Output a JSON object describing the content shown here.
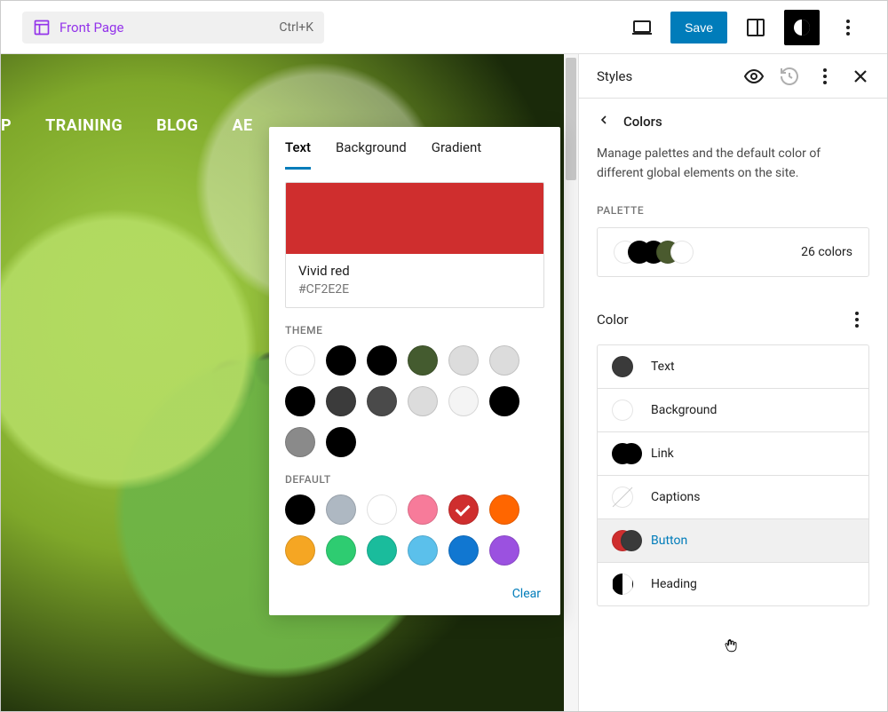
{
  "toolbar": {
    "page_name": "Front Page",
    "shortcut": "Ctrl+K",
    "save_label": "Save"
  },
  "canvas": {
    "nav_items": [
      "P",
      "TRAINING",
      "BLOG",
      "AE"
    ]
  },
  "popover": {
    "tabs": [
      {
        "label": "Text",
        "active": true
      },
      {
        "label": "Background",
        "active": false
      },
      {
        "label": "Gradient",
        "active": false
      }
    ],
    "current_swatch": {
      "name": "Vivid red",
      "hex": "#CF2E2E",
      "color": "#CF2E2E"
    },
    "sections": {
      "theme_label": "THEME",
      "default_label": "DEFAULT"
    },
    "theme_colors": [
      "#ffffff",
      "#000000",
      "#000000",
      "#445b2f",
      "#dcdcdc",
      "#dcdcdc",
      "#000000",
      "#3b3b3b",
      "#4a4a4a",
      "#dcdcdc",
      "#f4f4f4",
      "#000000",
      "#8a8a8a",
      "#000000"
    ],
    "default_colors": [
      {
        "c": "#000000"
      },
      {
        "c": "#aeb8c2"
      },
      {
        "c": "#ffffff"
      },
      {
        "c": "#f77b9a"
      },
      {
        "c": "#CF2E2E",
        "selected": true
      },
      {
        "c": "#ff6600"
      },
      {
        "c": "#f5a623"
      },
      {
        "c": "#2ecc71"
      },
      {
        "c": "#1abc9c"
      },
      {
        "c": "#5bc0eb"
      },
      {
        "c": "#1177d1"
      },
      {
        "c": "#9b51e0"
      }
    ],
    "clear_label": "Clear"
  },
  "sidebar": {
    "title": "Styles",
    "breadcrumb": "Colors",
    "description": "Manage palettes and the default color of different global elements on the site.",
    "palette_label": "PALETTE",
    "palette": {
      "dots": [
        "#ffffff",
        "#000000",
        "#000000",
        "#4a5a2e",
        "#ffffff"
      ],
      "count_label": "26 colors"
    },
    "color_heading": "Color",
    "rows": [
      {
        "id": "text",
        "label": "Text",
        "c1": "#3a3a3a",
        "c2": null
      },
      {
        "id": "background",
        "label": "Background",
        "c1": "#ffffff",
        "c2": null
      },
      {
        "id": "link",
        "label": "Link",
        "c1": "#000000",
        "c2": "#000000"
      },
      {
        "id": "captions",
        "label": "Captions",
        "c1": "empty",
        "c2": null
      },
      {
        "id": "button",
        "label": "Button",
        "c1": "#CF2E2E",
        "c2": "#3a3a3a",
        "selected": true
      },
      {
        "id": "heading",
        "label": "Heading",
        "c1": "half",
        "c2": null
      }
    ]
  }
}
